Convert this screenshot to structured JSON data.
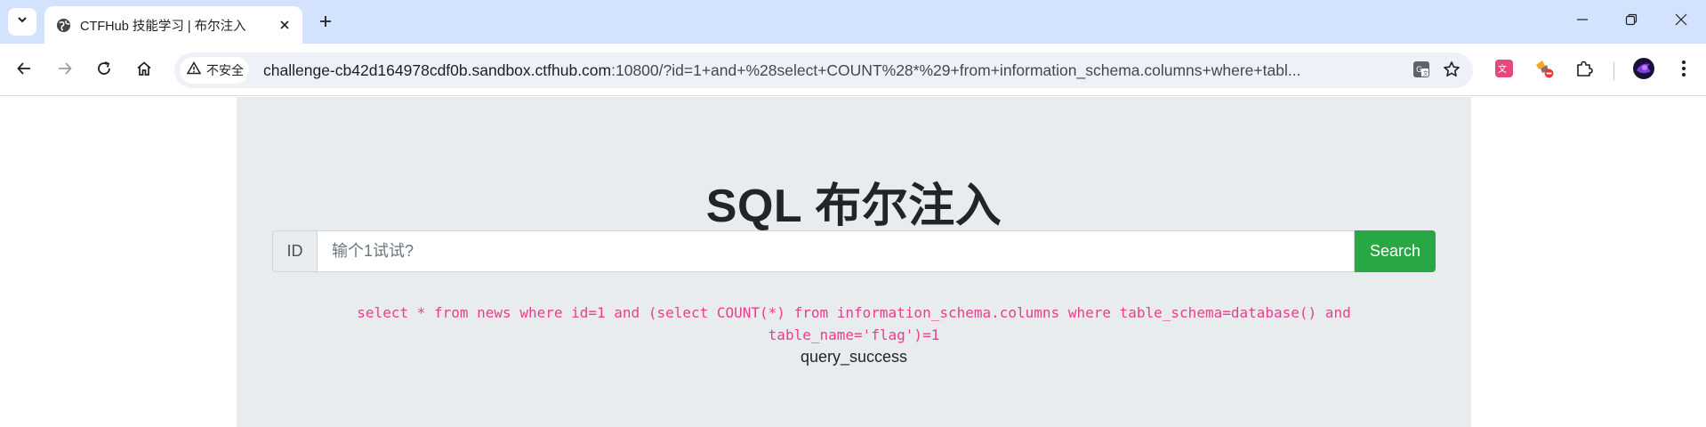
{
  "browser": {
    "tab": {
      "title": "CTFHub 技能学习 | 布尔注入"
    },
    "security_chip": {
      "label": "不安全"
    },
    "url": {
      "host": "challenge-cb42d164978cdf0b.sandbox.ctfhub.com",
      "rest": ":10800/?id=1+and+%28select+COUNT%28*%29+from+information_schema.columns+where+tabl..."
    },
    "colors": {
      "tabstrip_bg": "#d3e3fd",
      "omnibox_bg": "#eef2f8"
    }
  },
  "page": {
    "heading": "SQL 布尔注入",
    "form": {
      "prepend_label": "ID",
      "input_placeholder": "输个1试试?",
      "input_value": "",
      "search_label": "Search"
    },
    "query_line1": "select * from news where id=1 and (select COUNT(*) from information_schema.columns where table_schema=database() and",
    "query_line2": "table_name='flag')=1",
    "result": "query_success",
    "colors": {
      "jumbotron_bg": "#e9ecef",
      "button": "#28a745",
      "query_text": "#e83e8c"
    }
  }
}
